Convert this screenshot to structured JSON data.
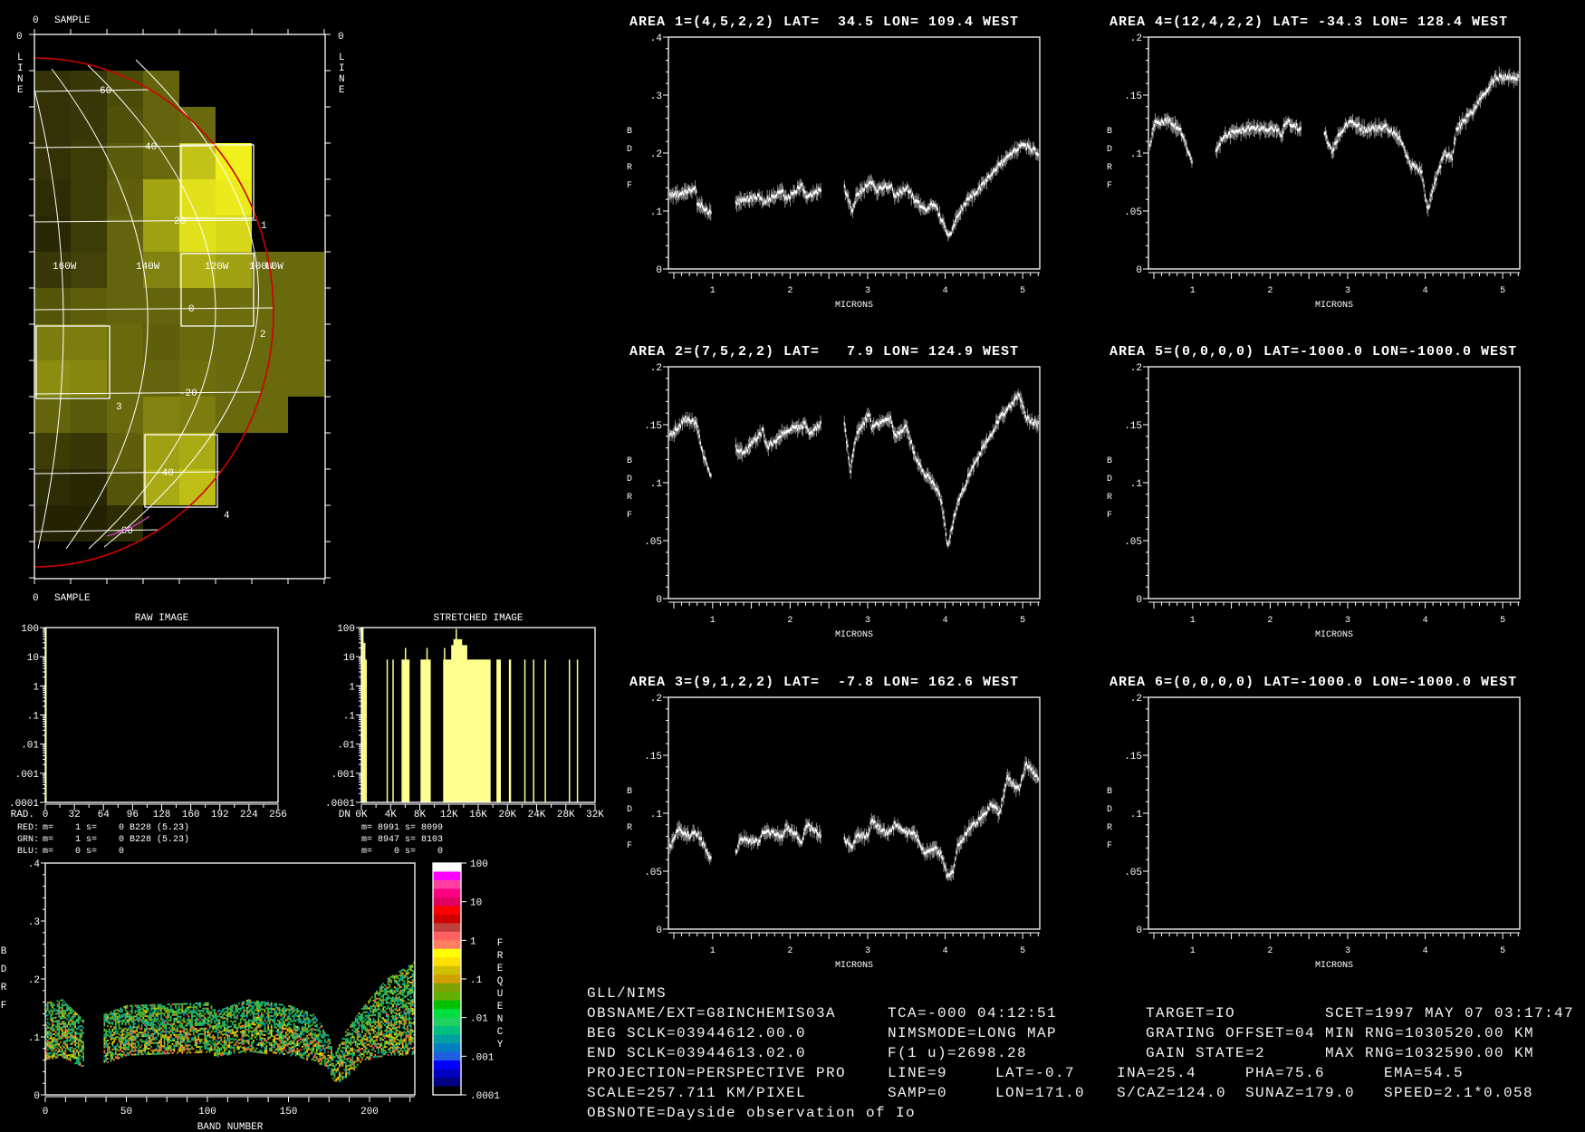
{
  "map": {
    "sample_label": "SAMPLE",
    "zero_label": "0",
    "line_letters": [
      "L",
      "I",
      "N",
      "E"
    ],
    "lat_labels": [
      "60",
      "40",
      "20",
      "0",
      "-20",
      "-40",
      "-60"
    ],
    "lon_labels": [
      "160W",
      "140W",
      "120W",
      "100W",
      "80W"
    ],
    "area_labels": [
      "1",
      "2",
      "3",
      "4"
    ],
    "limb_color": "#d00000",
    "cells": [
      [
        0,
        0,
        0,
        0,
        0,
        0,
        0,
        0
      ],
      [
        50,
        55,
        75,
        100,
        0,
        0,
        0,
        0
      ],
      [
        50,
        55,
        80,
        100,
        105,
        0,
        0,
        0
      ],
      [
        50,
        60,
        90,
        105,
        195,
        240,
        0,
        0
      ],
      [
        45,
        60,
        95,
        165,
        225,
        235,
        0,
        0
      ],
      [
        40,
        60,
        100,
        160,
        225,
        215,
        0,
        0
      ],
      [
        55,
        65,
        100,
        130,
        175,
        160,
        105,
        105
      ],
      [
        85,
        95,
        100,
        100,
        110,
        110,
        105,
        105
      ],
      [
        125,
        125,
        105,
        95,
        105,
        105,
        105,
        105
      ],
      [
        140,
        135,
        105,
        100,
        110,
        105,
        105,
        105
      ],
      [
        100,
        90,
        105,
        130,
        125,
        105,
        105,
        0
      ],
      [
        60,
        55,
        95,
        160,
        170,
        0,
        0,
        0
      ],
      [
        45,
        40,
        85,
        170,
        190,
        0,
        0,
        0
      ],
      [
        35,
        35,
        45,
        0,
        0,
        0,
        0,
        0
      ],
      [
        0,
        0,
        0,
        0,
        0,
        0,
        0,
        0
      ]
    ]
  },
  "histograms": {
    "y_ticks": [
      "100",
      "10",
      "1",
      ".1",
      ".01",
      ".001",
      ".0001"
    ],
    "raw": {
      "title": "RAW IMAGE",
      "axis_label": "RAD.",
      "x_ticks": [
        "0",
        "32",
        "64",
        "96",
        "128",
        "160",
        "192",
        "224",
        "256"
      ],
      "x_range": [
        0,
        256
      ],
      "bars": [
        [
          0,
          1.5,
          100
        ]
      ]
    },
    "stretched": {
      "title": "STRETCHED IMAGE",
      "axis_label": "DN",
      "x_ticks": [
        "0K",
        "4K",
        "8K",
        "12K",
        "16K",
        "20K",
        "24K",
        "28K",
        "32K"
      ],
      "x_range": [
        0,
        32
      ],
      "bars": [
        [
          0,
          0.3,
          100
        ],
        [
          0.3,
          0.55,
          30
        ],
        [
          0.55,
          0.75,
          8
        ],
        [
          3.45,
          3.5,
          8
        ],
        [
          4.25,
          4.3,
          8
        ],
        [
          5.5,
          6.6,
          8
        ],
        [
          5.95,
          6.1,
          20
        ],
        [
          8.1,
          9.5,
          8
        ],
        [
          8.9,
          9.05,
          20
        ],
        [
          11.2,
          17.7,
          8
        ],
        [
          11.3,
          11.4,
          20
        ],
        [
          12.3,
          14.5,
          25
        ],
        [
          12.6,
          13.8,
          40
        ],
        [
          12.9,
          12.95,
          90
        ],
        [
          18.5,
          19.1,
          8
        ],
        [
          20.2,
          20.5,
          8
        ],
        [
          22.3,
          22.35,
          8
        ],
        [
          23.5,
          23.55,
          8
        ],
        [
          25.1,
          25.15,
          8
        ],
        [
          28.4,
          28.55,
          8
        ],
        [
          29.5,
          29.55,
          8
        ]
      ],
      "bar_color": "#ffff90"
    },
    "stats": {
      "red": {
        "label": "RED:",
        "text": "m=    1 s=    0 B228 (5.23)",
        "color": "#e02020"
      },
      "grn": {
        "label": "GRN:",
        "text": "m=    1 s=    0 B228 (5.23)",
        "color": "#e8e890"
      },
      "blu": {
        "label": "BLU:",
        "text": "m=    0 s=    0",
        "color": "#5050e0"
      },
      "stretched": [
        "m= 8991 s= 8099",
        "m= 8947 s= 8103",
        "m=    0 s=    0"
      ]
    }
  },
  "band_plot": {
    "xlabel": "BAND NUMBER",
    "ylabel_letters": [
      "B",
      "D",
      "R",
      "F"
    ],
    "x_ticks": [
      "0",
      "50",
      "100",
      "150",
      "200"
    ],
    "y_ticks": [
      ".4",
      ".3",
      ".2",
      ".1",
      "0"
    ],
    "xlim": [
      0,
      228
    ],
    "ylim": [
      0,
      0.4
    ],
    "envelope_segments": [
      [
        [
          0,
          0.06,
          0.16
        ],
        [
          10,
          0.065,
          0.165
        ],
        [
          23,
          0.05,
          0.13
        ]
      ],
      [
        [
          36,
          0.055,
          0.14
        ],
        [
          50,
          0.07,
          0.155
        ],
        [
          100,
          0.075,
          0.16
        ],
        [
          105,
          0.065,
          0.145
        ],
        [
          110,
          0.07,
          0.15
        ],
        [
          125,
          0.075,
          0.165
        ],
        [
          150,
          0.07,
          0.155
        ],
        [
          165,
          0.06,
          0.14
        ],
        [
          175,
          0.045,
          0.1
        ],
        [
          178,
          0.02,
          0.07
        ],
        [
          185,
          0.03,
          0.11
        ],
        [
          195,
          0.06,
          0.15
        ],
        [
          210,
          0.07,
          0.2
        ],
        [
          227,
          0.07,
          0.23
        ]
      ]
    ]
  },
  "colorbar": {
    "title_letters": [
      "F",
      "R",
      "E",
      "Q",
      "U",
      "E",
      "N",
      "C",
      "Y"
    ],
    "labels": [
      "100",
      "10",
      "1",
      ".1",
      ".01",
      ".001",
      ".0001"
    ],
    "colors": [
      "#ffffff",
      "#ff00ff",
      "#ff40a0",
      "#ff0080",
      "#e00060",
      "#ff0000",
      "#d00000",
      "#c04040",
      "#ff6060",
      "#ff8060",
      "#ffff00",
      "#ffe000",
      "#d0c000",
      "#d0a000",
      "#80a000",
      "#60b000",
      "#00c000",
      "#00e040",
      "#20d060",
      "#00c080",
      "#00a0a0",
      "#0080c0",
      "#2060e0",
      "#0000ff",
      "#0000c0",
      "#000080",
      "#000000"
    ]
  },
  "spectra": [
    {
      "title": "AREA 1=(4,5,2,2) LAT=  34.5 LON= 109.4 WEST",
      "ylim": [
        0,
        0.4
      ],
      "y_ticks": [
        {
          "v": 0.4,
          "label": ".4"
        },
        {
          "v": 0.3,
          "label": ".3"
        },
        {
          "v": 0.2,
          "label": ".2"
        },
        {
          "v": 0.1,
          "label": ".1"
        },
        {
          "v": 0,
          "label": "0"
        }
      ],
      "segments": [
        [
          [
            0.45,
            0.125
          ],
          [
            0.6,
            0.13
          ],
          [
            0.78,
            0.14
          ],
          [
            0.8,
            0.115
          ],
          [
            0.98,
            0.095
          ]
        ],
        [
          [
            1.3,
            0.115
          ],
          [
            1.6,
            0.125
          ],
          [
            1.65,
            0.115
          ],
          [
            1.9,
            0.135
          ],
          [
            1.95,
            0.12
          ],
          [
            2.15,
            0.145
          ],
          [
            2.2,
            0.125
          ],
          [
            2.4,
            0.135
          ]
        ],
        [
          [
            2.7,
            0.14
          ],
          [
            2.8,
            0.1
          ],
          [
            2.85,
            0.125
          ],
          [
            3.05,
            0.15
          ],
          [
            3.1,
            0.135
          ],
          [
            3.3,
            0.145
          ],
          [
            3.35,
            0.125
          ],
          [
            3.5,
            0.14
          ],
          [
            3.6,
            0.12
          ],
          [
            3.75,
            0.1
          ],
          [
            3.85,
            0.115
          ],
          [
            3.95,
            0.085
          ],
          [
            4.05,
            0.055
          ],
          [
            4.15,
            0.09
          ],
          [
            4.3,
            0.12
          ],
          [
            4.45,
            0.14
          ],
          [
            4.7,
            0.18
          ],
          [
            5.0,
            0.215
          ],
          [
            5.2,
            0.2
          ]
        ]
      ]
    },
    {
      "title": "AREA 2=(7,5,2,2) LAT=   7.9 LON= 124.9 WEST",
      "ylim": [
        0,
        0.2
      ],
      "y_ticks": [
        {
          "v": 0.2,
          "label": ".2"
        },
        {
          "v": 0.15,
          "label": ".15"
        },
        {
          "v": 0.1,
          "label": ".1"
        },
        {
          "v": 0.05,
          "label": ".05"
        },
        {
          "v": 0,
          "label": "0"
        }
      ],
      "segments": [
        [
          [
            0.45,
            0.14
          ],
          [
            0.65,
            0.155
          ],
          [
            0.8,
            0.15
          ],
          [
            0.85,
            0.13
          ],
          [
            0.98,
            0.105
          ]
        ],
        [
          [
            1.3,
            0.13
          ],
          [
            1.4,
            0.125
          ],
          [
            1.65,
            0.145
          ],
          [
            1.7,
            0.13
          ],
          [
            1.95,
            0.145
          ],
          [
            2.2,
            0.15
          ],
          [
            2.25,
            0.14
          ],
          [
            2.4,
            0.152
          ]
        ],
        [
          [
            2.7,
            0.15
          ],
          [
            2.78,
            0.11
          ],
          [
            2.85,
            0.14
          ],
          [
            3.02,
            0.16
          ],
          [
            3.05,
            0.148
          ],
          [
            3.3,
            0.155
          ],
          [
            3.35,
            0.14
          ],
          [
            3.5,
            0.148
          ],
          [
            3.6,
            0.125
          ],
          [
            3.7,
            0.11
          ],
          [
            3.85,
            0.1
          ],
          [
            3.95,
            0.085
          ],
          [
            4.03,
            0.045
          ],
          [
            4.15,
            0.08
          ],
          [
            4.3,
            0.105
          ],
          [
            4.45,
            0.125
          ],
          [
            4.7,
            0.155
          ],
          [
            4.95,
            0.175
          ],
          [
            5.05,
            0.155
          ],
          [
            5.2,
            0.15
          ]
        ]
      ]
    },
    {
      "title": "AREA 3=(9,1,2,2) LAT=  -7.8 LON= 162.6 WEST",
      "ylim": [
        0,
        0.2
      ],
      "y_ticks": [
        {
          "v": 0.2,
          "label": ".2"
        },
        {
          "v": 0.15,
          "label": ".15"
        },
        {
          "v": 0.1,
          "label": ".1"
        },
        {
          "v": 0.05,
          "label": ".05"
        },
        {
          "v": 0,
          "label": "0"
        }
      ],
      "segments": [
        [
          [
            0.45,
            0.07
          ],
          [
            0.55,
            0.087
          ],
          [
            0.7,
            0.08
          ],
          [
            0.8,
            0.083
          ],
          [
            0.98,
            0.06
          ]
        ],
        [
          [
            1.3,
            0.065
          ],
          [
            1.35,
            0.078
          ],
          [
            1.6,
            0.075
          ],
          [
            1.65,
            0.085
          ],
          [
            1.9,
            0.08
          ],
          [
            1.95,
            0.088
          ],
          [
            2.1,
            0.08
          ],
          [
            2.15,
            0.075
          ],
          [
            2.2,
            0.09
          ],
          [
            2.4,
            0.08
          ]
        ],
        [
          [
            2.7,
            0.078
          ],
          [
            2.8,
            0.07
          ],
          [
            2.85,
            0.08
          ],
          [
            3.0,
            0.08
          ],
          [
            3.05,
            0.093
          ],
          [
            3.25,
            0.082
          ],
          [
            3.35,
            0.09
          ],
          [
            3.5,
            0.083
          ],
          [
            3.6,
            0.083
          ],
          [
            3.75,
            0.065
          ],
          [
            3.85,
            0.07
          ],
          [
            3.95,
            0.065
          ],
          [
            4.03,
            0.045
          ],
          [
            4.1,
            0.048
          ],
          [
            4.15,
            0.07
          ],
          [
            4.3,
            0.085
          ],
          [
            4.45,
            0.095
          ],
          [
            4.6,
            0.107
          ],
          [
            4.7,
            0.1
          ],
          [
            4.8,
            0.13
          ],
          [
            4.95,
            0.12
          ],
          [
            5.05,
            0.143
          ],
          [
            5.2,
            0.13
          ]
        ]
      ]
    },
    {
      "title": "AREA 4=(12,4,2,2) LAT= -34.3 LON= 128.4 WEST",
      "ylim": [
        0,
        0.2
      ],
      "y_ticks": [
        {
          "v": 0.2,
          "label": ".2"
        },
        {
          "v": 0.15,
          "label": ".15"
        },
        {
          "v": 0.1,
          "label": ".1"
        },
        {
          "v": 0.05,
          "label": ".05"
        },
        {
          "v": 0,
          "label": "0"
        }
      ],
      "segments": [
        [
          [
            0.45,
            0.105
          ],
          [
            0.5,
            0.125
          ],
          [
            0.7,
            0.128
          ],
          [
            0.85,
            0.118
          ],
          [
            1.0,
            0.09
          ]
        ],
        [
          [
            1.3,
            0.1
          ],
          [
            1.4,
            0.115
          ],
          [
            1.8,
            0.122
          ],
          [
            2.1,
            0.12
          ],
          [
            2.15,
            0.115
          ],
          [
            2.2,
            0.128
          ],
          [
            2.4,
            0.12
          ]
        ],
        [
          [
            2.7,
            0.118
          ],
          [
            2.8,
            0.1
          ],
          [
            2.9,
            0.118
          ],
          [
            3.05,
            0.128
          ],
          [
            3.2,
            0.12
          ],
          [
            3.5,
            0.122
          ],
          [
            3.7,
            0.11
          ],
          [
            3.8,
            0.09
          ],
          [
            3.95,
            0.085
          ],
          [
            4.03,
            0.05
          ],
          [
            4.15,
            0.08
          ],
          [
            4.25,
            0.1
          ],
          [
            4.35,
            0.095
          ],
          [
            4.4,
            0.12
          ],
          [
            4.6,
            0.135
          ],
          [
            4.9,
            0.165
          ],
          [
            5.2,
            0.165
          ]
        ]
      ]
    },
    {
      "title": "AREA 5=(0,0,0,0) LAT=-1000.0 LON=-1000.0 WEST",
      "ylim": [
        0,
        0.2
      ],
      "y_ticks": [
        {
          "v": 0.2,
          "label": ".2"
        },
        {
          "v": 0.15,
          "label": ".15"
        },
        {
          "v": 0.1,
          "label": ".1"
        },
        {
          "v": 0.05,
          "label": ".05"
        },
        {
          "v": 0,
          "label": "0"
        }
      ],
      "segments": []
    },
    {
      "title": "AREA 6=(0,0,0,0) LAT=-1000.0 LON=-1000.0 WEST",
      "ylim": [
        0,
        0.2
      ],
      "y_ticks": [
        {
          "v": 0.2,
          "label": ".2"
        },
        {
          "v": 0.15,
          "label": ".15"
        },
        {
          "v": 0.1,
          "label": ".1"
        },
        {
          "v": 0.05,
          "label": ".05"
        },
        {
          "v": 0,
          "label": "0"
        }
      ],
      "segments": []
    }
  ],
  "spectra_common": {
    "xlabel": "MICRONS",
    "ylabel_letters": [
      "B",
      "D",
      "R",
      "F"
    ],
    "xlim": [
      0.43,
      5.22
    ],
    "x_ticks": [
      "1",
      "2",
      "3",
      "4",
      "5"
    ]
  },
  "info": {
    "rows": [
      [
        "GLL/NIMS"
      ],
      [
        "OBSNAME/EXT=G8INCHEMIS03A",
        "TCA=-000 04:12:51",
        "TARGET=IO",
        "SCET=1997 MAY 07 03:17:47"
      ],
      [
        "BEG SCLK=03944612.00.0",
        "NIMSMODE=LONG MAP",
        "GRATING OFFSET=04",
        "MIN RNG=1030520.00 KM"
      ],
      [
        "END SCLK=03944613.02.0",
        "F(1 u)=2698.28",
        "GAIN STATE=2",
        "MAX RNG=1032590.00 KM"
      ],
      [
        "PROJECTION=PERSPECTIVE PRO",
        "LINE=9",
        "LAT=-0.7",
        "INA=25.4",
        "PHA=75.6",
        "EMA=54.5"
      ],
      [
        "SCALE=257.711 KM/PIXEL",
        "SAMP=0",
        "LON=171.0",
        "S/CAZ=124.0",
        "SUNAZ=179.0",
        "SPEED=2.1*0.058"
      ],
      [
        "OBSNOTE=Dayside observation of Io"
      ]
    ]
  }
}
